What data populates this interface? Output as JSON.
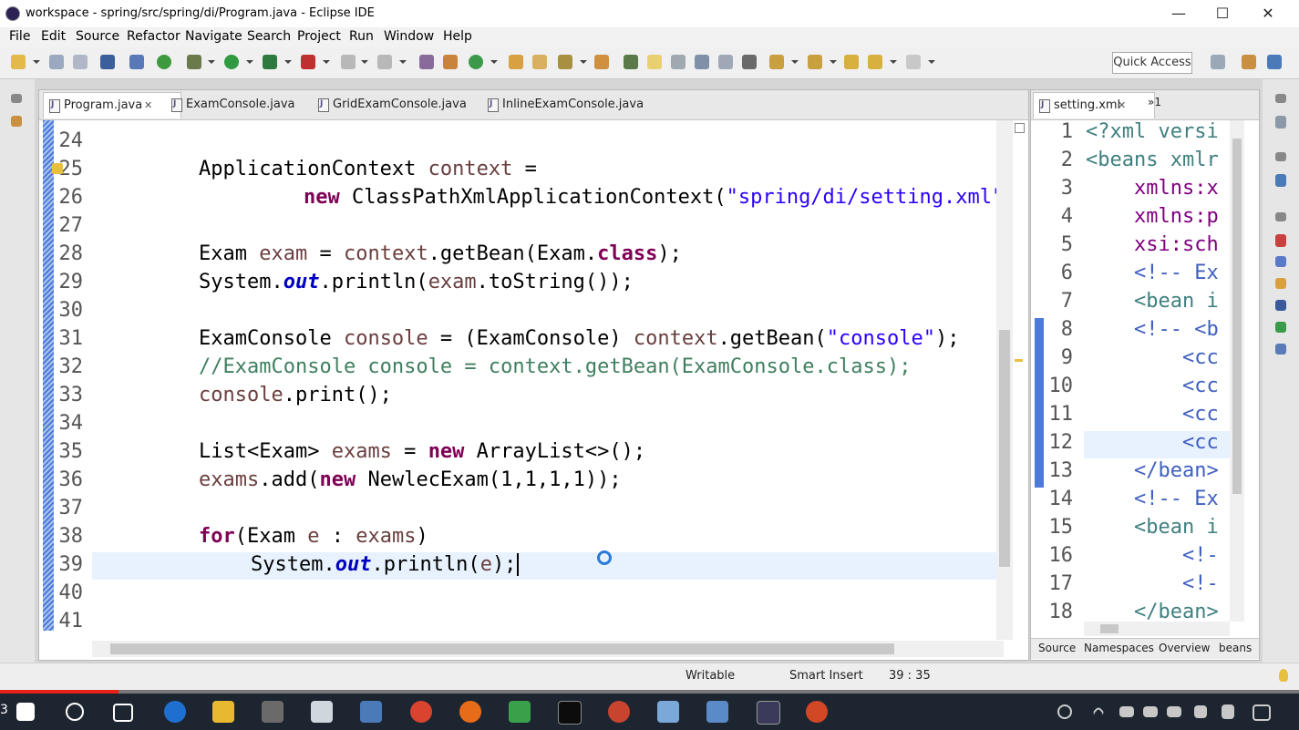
{
  "window": {
    "title": "workspace - spring/src/spring/di/Program.java - Eclipse IDE",
    "min": "—",
    "max": "☐",
    "close": "✕"
  },
  "menu": [
    "File",
    "Edit",
    "Source",
    "Refactor",
    "Navigate",
    "Search",
    "Project",
    "Run",
    "Window",
    "Help"
  ],
  "toolbar": {
    "quick_access": "Quick Access"
  },
  "editor": {
    "tabs": [
      {
        "label": "Program.java",
        "close": "✕",
        "active": true
      },
      {
        "label": "ExamConsole.java"
      },
      {
        "label": "GridExamConsole.java"
      },
      {
        "label": "InlineExamConsole.java"
      }
    ],
    "line_numbers": [
      "24",
      "25",
      "26",
      "27",
      "28",
      "29",
      "30",
      "31",
      "32",
      "33",
      "34",
      "35",
      "36",
      "37",
      "38",
      "39",
      "40",
      "41"
    ]
  },
  "xml": {
    "tab_label": "setting.xml",
    "tab_overflow": "»1",
    "line_numbers": [
      "1",
      "2",
      "3",
      "4",
      "5",
      "6",
      "7",
      "8",
      "9",
      "10",
      "11",
      "12",
      "13",
      "14",
      "15",
      "16",
      "17",
      "18"
    ],
    "lines": [
      "<?xml versi",
      "<beans xmlr",
      "    xmlns:x",
      "    xmlns:p",
      "    xsi:sch",
      "    <!-- Ex",
      "    <bean i",
      "    <!-- <b",
      "        <cc",
      "        <cc",
      "        <cc",
      "        <cc",
      "    </bean>",
      "    <!-- Ex",
      "    <bean i",
      "        <!-",
      "        <!-",
      "    </bean>"
    ],
    "bottom_tabs": [
      "Source",
      "Namespaces",
      "Overview",
      "beans"
    ]
  },
  "status": {
    "writable": "Writable",
    "insert_mode": "Smart Insert",
    "position": "39 : 35"
  },
  "taskbar": {
    "left_label": "3"
  },
  "colors": {
    "keyword": "#7f0055",
    "string": "#2a00ff",
    "comment": "#3f7f5f",
    "field": "#0000c0",
    "current_line": "#e8f2fe"
  }
}
